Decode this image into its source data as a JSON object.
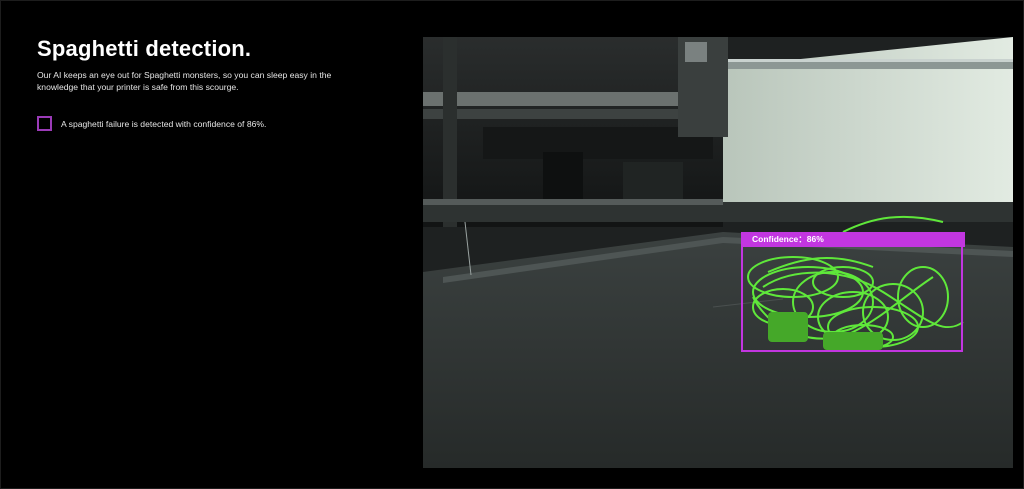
{
  "header": {
    "title": "Spaghetti detection.",
    "description": "Our AI keeps an eye out for Spaghetti monsters, so you can sleep easy in the knowledge that your printer is safe from this scourge."
  },
  "legend": {
    "text": "A spaghetti failure is detected with confidence of 86%.",
    "swatch_color": "#9b3bb8"
  },
  "detection": {
    "label": "Confidence：86%",
    "box_color": "#c236e0",
    "filament_color": "#5fe83a"
  }
}
